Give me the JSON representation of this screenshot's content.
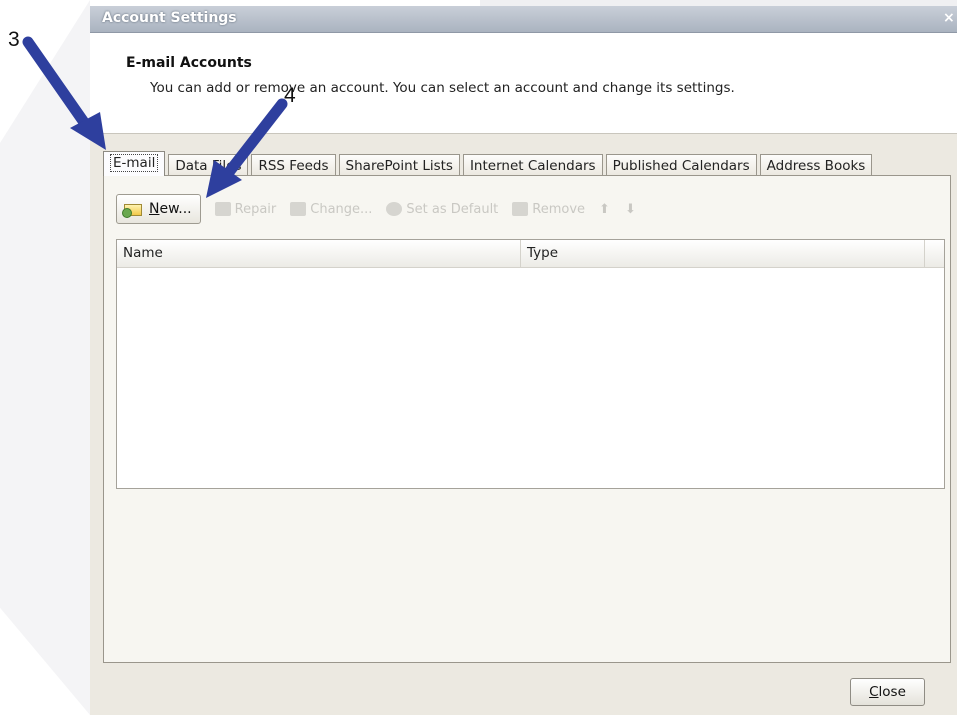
{
  "dialog": {
    "title": "Account Settings",
    "close_glyph": "×"
  },
  "header": {
    "title": "E-mail Accounts",
    "description": "You can add or remove an account. You can select an account and change its settings."
  },
  "tabs": [
    {
      "label": "E-mail",
      "active": true
    },
    {
      "label": "Data Files",
      "active": false
    },
    {
      "label": "RSS Feeds",
      "active": false
    },
    {
      "label": "SharePoint Lists",
      "active": false
    },
    {
      "label": "Internet Calendars",
      "active": false
    },
    {
      "label": "Published Calendars",
      "active": false
    },
    {
      "label": "Address Books",
      "active": false
    }
  ],
  "toolbar": {
    "new_prefix": "",
    "new_accel": "N",
    "new_rest": "ew...",
    "new_icon": "new-account-envelope-icon",
    "disabled_items": [
      {
        "label": "Repair",
        "icon": "repair-icon"
      },
      {
        "label": "Change...",
        "icon": "change-icon"
      },
      {
        "label": "Set as Default",
        "icon": "set-default-icon"
      },
      {
        "label": "Remove",
        "icon": "remove-icon"
      }
    ],
    "move_up_glyph": "⬆",
    "move_down_glyph": "⬇"
  },
  "list": {
    "columns": [
      "Name",
      "Type"
    ],
    "rows": []
  },
  "footer": {
    "close_accel": "C",
    "close_rest": "lose"
  },
  "annotations": {
    "callout_3": "3",
    "callout_4": "4"
  },
  "colors": {
    "arrow": "#2e3f9e",
    "dialog_bg": "#ece9e1",
    "titlebar": "#aab3c0"
  }
}
